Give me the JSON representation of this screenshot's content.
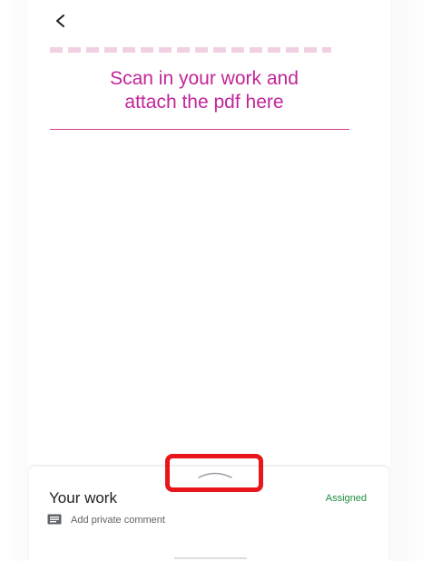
{
  "header": {
    "back_icon": "chevron-left-icon"
  },
  "callout": {
    "line1": "Scan in your work and",
    "line2": "attach the pdf here",
    "color": "#c22599"
  },
  "your_work": {
    "title": "Your work",
    "status": "Assigned",
    "status_color": "#1e8e3e",
    "comment_icon": "comment-icon",
    "comment_label": "Add private comment",
    "handle_icon": "chevron-up-icon",
    "highlight_color": "#e8161b"
  }
}
